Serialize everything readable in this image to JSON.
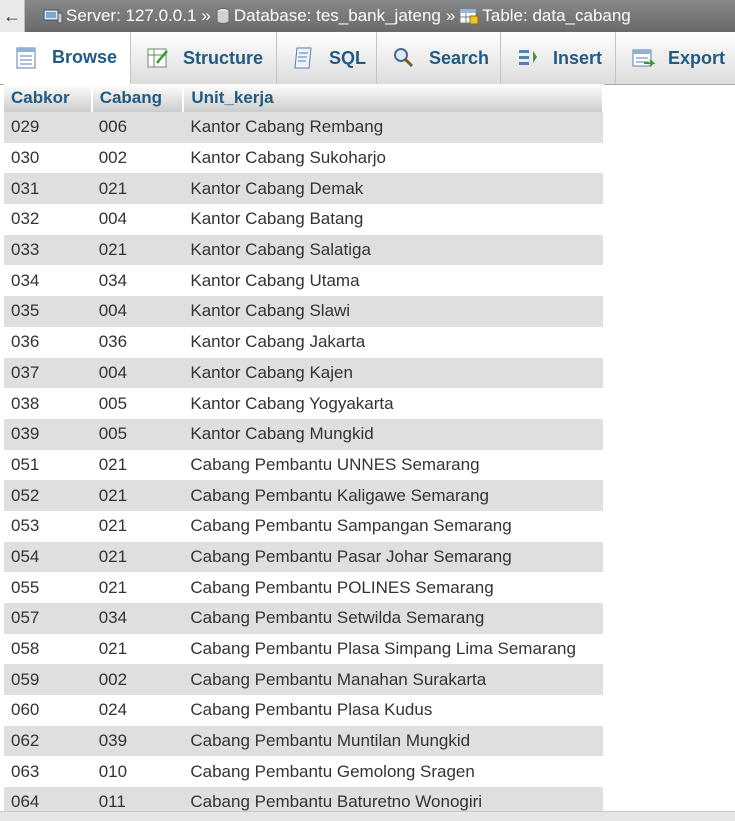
{
  "breadcrumb": {
    "server": "Server: 127.0.0.1",
    "database": "Database: tes_bank_jateng",
    "table": "Table: data_cabang",
    "separator": "»"
  },
  "tabs": [
    {
      "label": "Browse",
      "icon": "browse-icon"
    },
    {
      "label": "Structure",
      "icon": "structure-icon"
    },
    {
      "label": "SQL",
      "icon": "sql-icon"
    },
    {
      "label": "Search",
      "icon": "search-icon"
    },
    {
      "label": "Insert",
      "icon": "insert-icon"
    },
    {
      "label": "Export",
      "icon": "export-icon"
    }
  ],
  "table": {
    "columns": [
      "Cabkor",
      "Cabang",
      "Unit_kerja"
    ],
    "rows": [
      [
        "029",
        "006",
        "Kantor Cabang Rembang"
      ],
      [
        "030",
        "002",
        "Kantor Cabang Sukoharjo"
      ],
      [
        "031",
        "021",
        "Kantor Cabang Demak"
      ],
      [
        "032",
        "004",
        "Kantor Cabang Batang"
      ],
      [
        "033",
        "021",
        "Kantor Cabang Salatiga"
      ],
      [
        "034",
        "034",
        "Kantor Cabang Utama"
      ],
      [
        "035",
        "004",
        "Kantor Cabang Slawi"
      ],
      [
        "036",
        "036",
        "Kantor Cabang Jakarta"
      ],
      [
        "037",
        "004",
        "Kantor Cabang Kajen"
      ],
      [
        "038",
        "005",
        "Kantor Cabang Yogyakarta"
      ],
      [
        "039",
        "005",
        "Kantor Cabang Mungkid"
      ],
      [
        "051",
        "021",
        "Cabang Pembantu UNNES Semarang"
      ],
      [
        "052",
        "021",
        "Cabang Pembantu Kaligawe Semarang"
      ],
      [
        "053",
        "021",
        "Cabang Pembantu Sampangan Semarang"
      ],
      [
        "054",
        "021",
        "Cabang Pembantu Pasar Johar Semarang"
      ],
      [
        "055",
        "021",
        "Cabang Pembantu POLINES Semarang"
      ],
      [
        "057",
        "034",
        "Cabang Pembantu Setwilda Semarang"
      ],
      [
        "058",
        "021",
        "Cabang Pembantu Plasa Simpang Lima Semarang"
      ],
      [
        "059",
        "002",
        "Cabang Pembantu Manahan Surakarta"
      ],
      [
        "060",
        "024",
        "Cabang Pembantu Plasa Kudus"
      ],
      [
        "062",
        "039",
        "Cabang Pembantu Muntilan Mungkid"
      ],
      [
        "063",
        "010",
        "Cabang Pembantu Gemolong Sragen"
      ],
      [
        "064",
        "011",
        "Cabang Pembantu Baturetno Wonogiri"
      ]
    ]
  },
  "colors": {
    "link": "#235a81",
    "row_odd": "#dfdfdf",
    "row_even": "#ffffff",
    "topbar": "#7a7a7a"
  }
}
